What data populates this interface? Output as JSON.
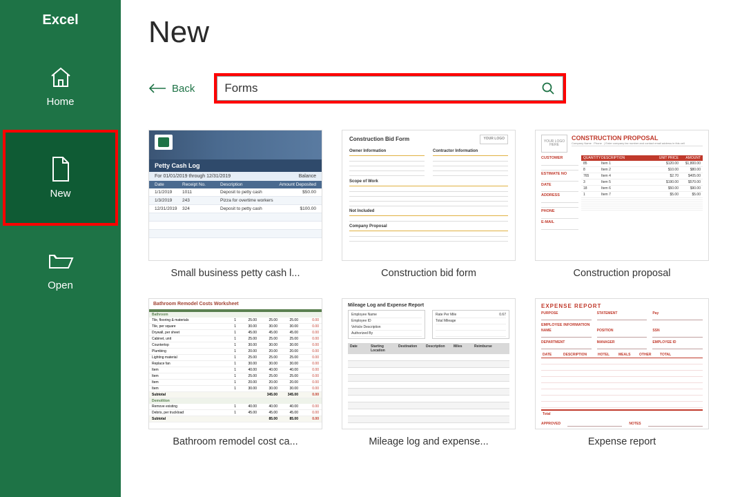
{
  "app_title": "Excel",
  "page_title": "New",
  "nav": {
    "home": "Home",
    "new": "New",
    "open": "Open"
  },
  "back_label": "Back",
  "search": {
    "value": "Forms"
  },
  "templates": [
    {
      "label": "Small business petty cash l..."
    },
    {
      "label": "Construction bid form"
    },
    {
      "label": "Construction proposal"
    },
    {
      "label": "Bathroom remodel cost ca..."
    },
    {
      "label": "Mileage log and expense..."
    },
    {
      "label": "Expense report"
    }
  ],
  "thumbs": {
    "petty": {
      "bar": "Petty Cash Log",
      "sub_left": "For 01/01/2019 through 12/31/2019",
      "sub_right": "Balance",
      "head": [
        "Date",
        "Receipt No.",
        "Description",
        "Amount Deposited"
      ],
      "rows": [
        [
          "1/1/2019",
          "1011",
          "Deposit to petty cash",
          "$50.00"
        ],
        [
          "1/3/2019",
          "243",
          "Pizza for overtime workers",
          ""
        ],
        [
          "12/31/2019",
          "324",
          "Deposit to petty cash",
          "$100.00"
        ]
      ]
    },
    "bid": {
      "title": "Construction Bid Form",
      "logo": "YOUR LOGO",
      "sec1": "Owner Information",
      "sec2": "Contractor Information",
      "scope": "Scope of Work",
      "notinc": "Not Included",
      "comp": "Company Proposal"
    },
    "proposal": {
      "logo": "YOUR LOGO HERE",
      "title": "CONSTRUCTION PROPOSAL",
      "th": [
        "QUANTITY",
        "DESCRIPTION",
        "UNIT PRICE",
        "AMOUNT"
      ],
      "left": [
        "CUSTOMER",
        "ESTIMATE NO",
        "DATE",
        "ADDRESS",
        "PHONE",
        "E-MAIL"
      ],
      "rows": [
        [
          "85",
          "Item 1",
          "$120.00",
          "$1,800.00"
        ],
        [
          "8",
          "Item 2",
          "$10.00",
          "$80.00"
        ],
        [
          "765",
          "Item 4",
          "$2.70",
          "$405.00"
        ],
        [
          "3",
          "Item 5",
          "$190.00",
          "$570.00"
        ],
        [
          "18",
          "Item 6",
          "$50.00",
          "$90.00"
        ],
        [
          "1",
          "Item 7",
          "$5.00",
          "$5.00"
        ]
      ]
    },
    "bathroom": {
      "title": "Bathroom Remodel Costs Worksheet"
    },
    "mileage": {
      "title": "Mileage Log and Expense Report"
    },
    "expense": {
      "title": "EXPENSE REPORT",
      "sec": "EMPLOYEE INFORMATION",
      "total": "Total",
      "approved": "APPROVED"
    }
  }
}
